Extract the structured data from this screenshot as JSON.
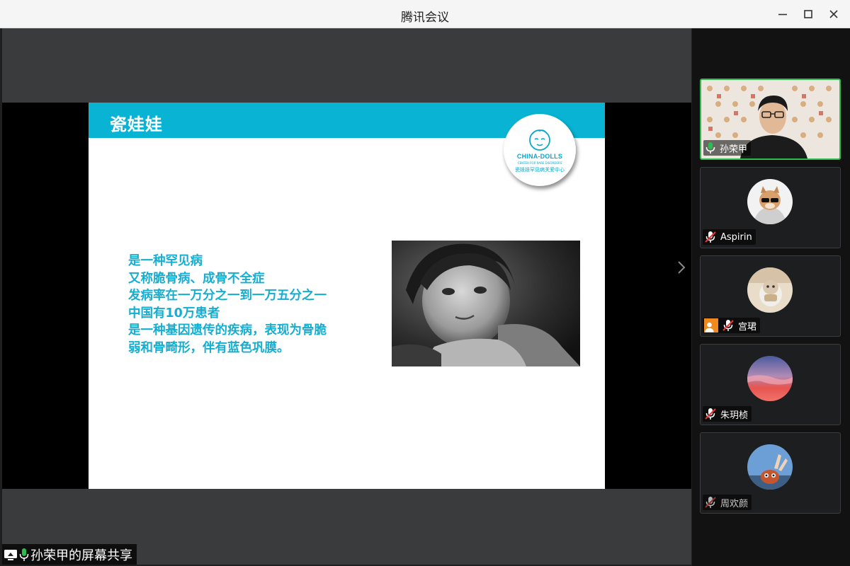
{
  "window": {
    "title": "腾讯会议"
  },
  "slide": {
    "title": "瓷娃娃",
    "logo": {
      "main": "CHINA-DOLLS",
      "sub_en": "CENTER FOR RARE DISORDERS",
      "sub_cn": "瓷娃娃罕见病关爱中心"
    },
    "lines": [
      "是一种罕见病",
      "又称脆骨病、成骨不全症",
      "发病率在一万分之一到一万五分之一",
      "中国有10万患者",
      "是一种基因遗传的疾病，表现为骨脆",
      "弱和骨畸形，伴有蓝色巩膜。"
    ]
  },
  "participants": [
    {
      "name": "孙荣甲",
      "mic": "on",
      "video": true,
      "active": true
    },
    {
      "name": "Aspirin",
      "mic": "muted",
      "video": false
    },
    {
      "name": "宫珺",
      "mic": "muted",
      "video": false,
      "screen_share_badge": true
    },
    {
      "name": "朱玥桢",
      "mic": "muted",
      "video": false
    },
    {
      "name": "周欢颜",
      "mic": "muted",
      "video": false,
      "dimmed": true
    }
  ],
  "share_label": "孙荣甲的屏幕共享",
  "colors": {
    "accent": "#08b3d3",
    "active_border": "#2fbc4f",
    "muted_mic": "#e23b3b"
  }
}
